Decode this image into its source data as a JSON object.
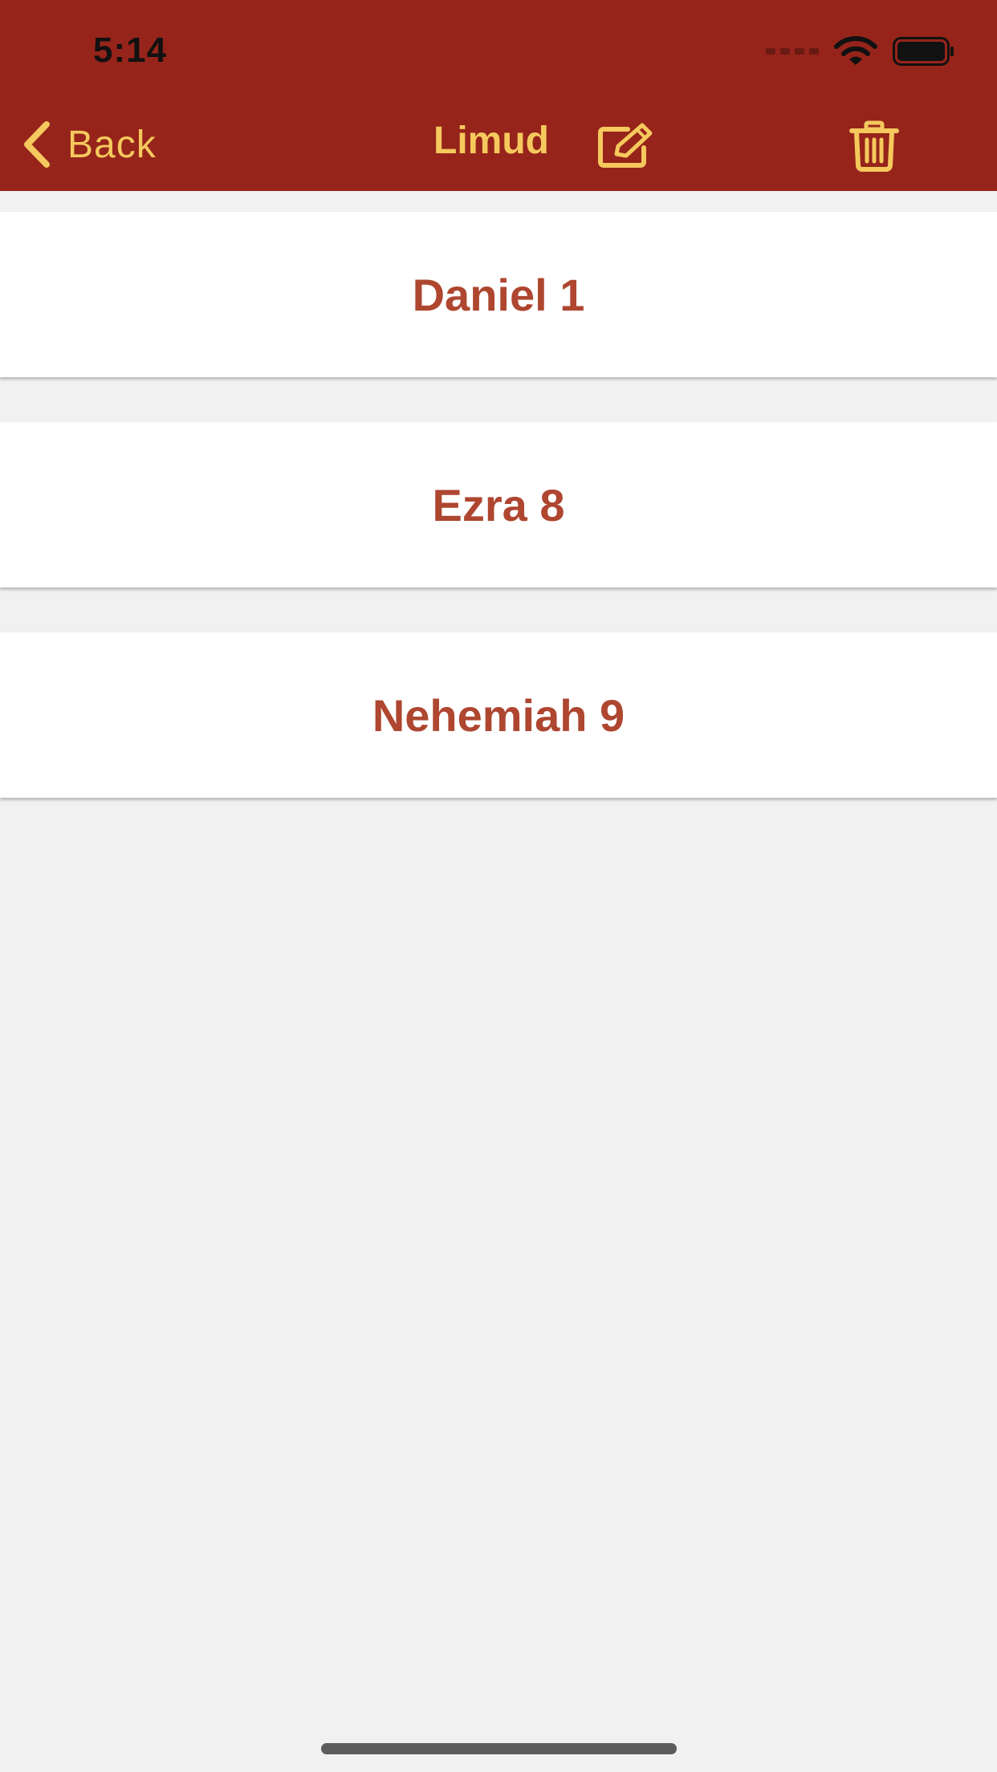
{
  "status_bar": {
    "time": "5:14"
  },
  "nav": {
    "back_label": "Back",
    "title": "Limud"
  },
  "items": [
    {
      "label": "Daniel 1"
    },
    {
      "label": "Ezra 8"
    },
    {
      "label": "Nehemiah 9"
    }
  ],
  "icons": {
    "back": "chevron-left-icon",
    "edit": "edit-icon",
    "delete": "trash-icon",
    "wifi": "wifi-icon",
    "battery": "battery-icon",
    "signal": "cellular-signal-icon"
  },
  "colors": {
    "nav_background": "#96241a",
    "nav_accent": "#f5c95d",
    "item_text": "#ae4630",
    "page_background": "#f1f1f1"
  }
}
